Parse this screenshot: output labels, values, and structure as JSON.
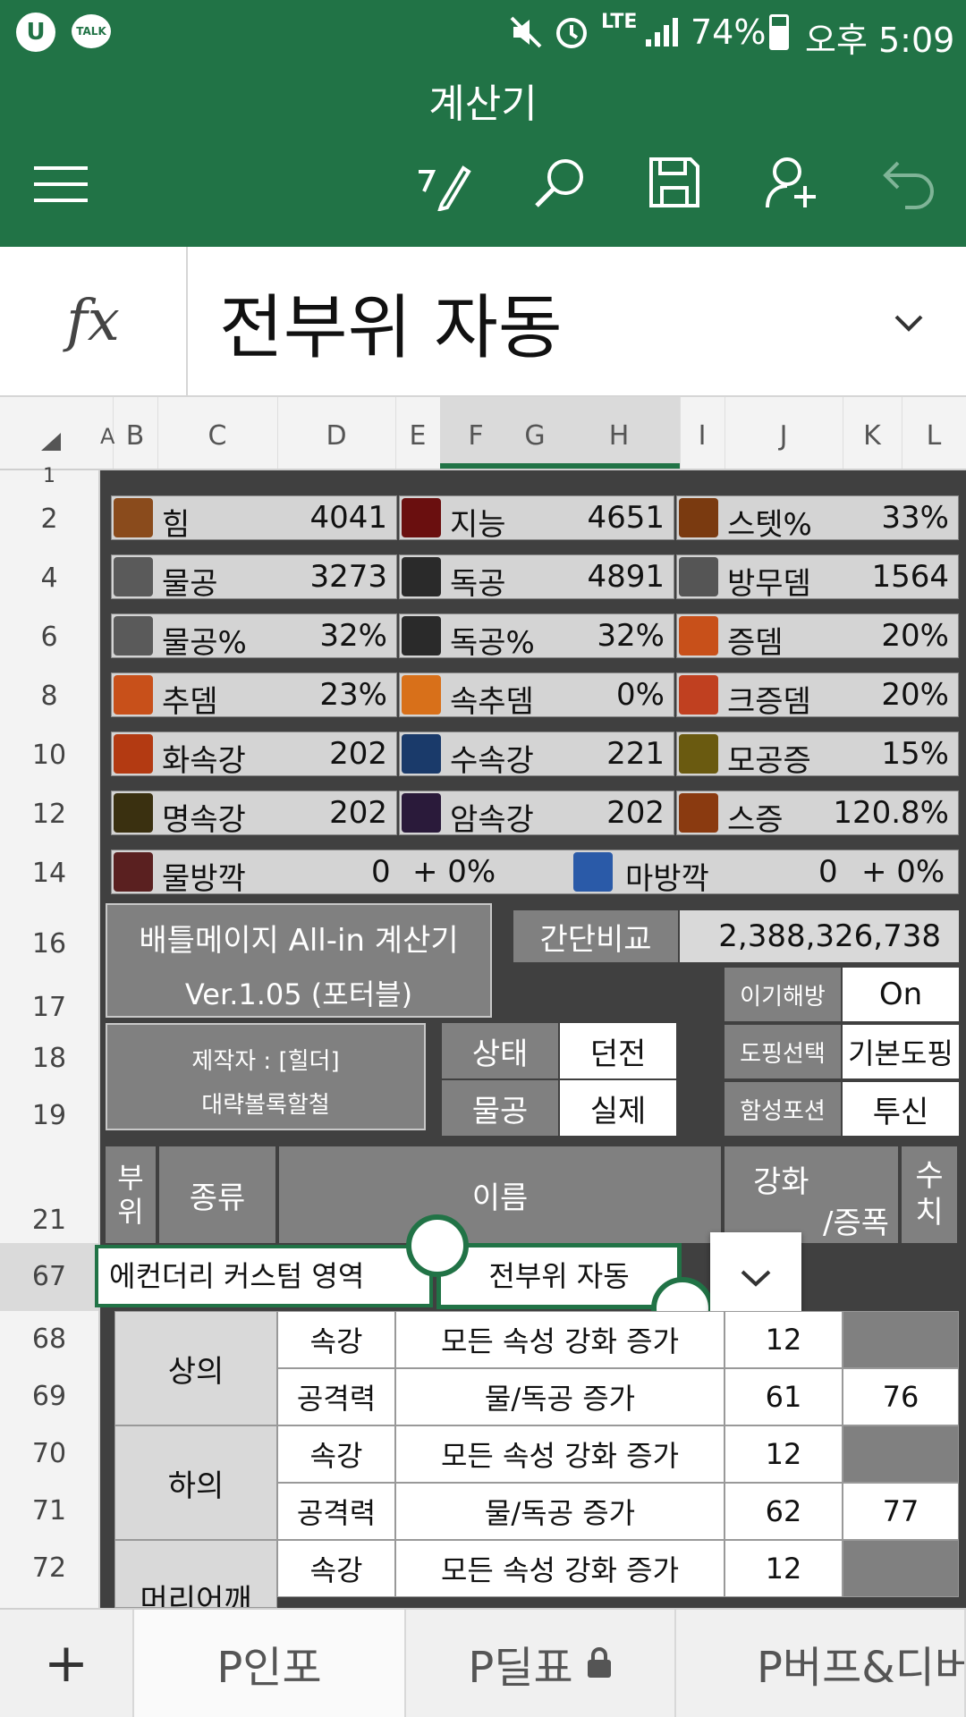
{
  "status_bar": {
    "battery": "74%",
    "time": "오후 5:09",
    "network": "LTE"
  },
  "app": {
    "title": "계산기"
  },
  "formula_bar": {
    "fx": "fx",
    "value": "전부위 자동"
  },
  "columns": [
    "A",
    "B",
    "C",
    "D",
    "E",
    "F",
    "G",
    "H",
    "I",
    "J",
    "K",
    "L"
  ],
  "rows": [
    "1",
    "2",
    "4",
    "6",
    "8",
    "10",
    "12",
    "14",
    "16",
    "17",
    "18",
    "19",
    "21",
    "67",
    "68",
    "69",
    "70",
    "71",
    "72"
  ],
  "stats": [
    {
      "label": "힘",
      "value": "4041"
    },
    {
      "label": "지능",
      "value": "4651"
    },
    {
      "label": "스텟%",
      "value": "33%"
    },
    {
      "label": "물공",
      "value": "3273"
    },
    {
      "label": "독공",
      "value": "4891"
    },
    {
      "label": "방무뎀",
      "value": "1564"
    },
    {
      "label": "물공%",
      "value": "32%"
    },
    {
      "label": "독공%",
      "value": "32%"
    },
    {
      "label": "증뎀",
      "value": "20%"
    },
    {
      "label": "추뎀",
      "value": "23%"
    },
    {
      "label": "속추뎀",
      "value": "0%"
    },
    {
      "label": "크증뎀",
      "value": "20%"
    },
    {
      "label": "화속강",
      "value": "202"
    },
    {
      "label": "수속강",
      "value": "221"
    },
    {
      "label": "모공증",
      "value": "15%"
    },
    {
      "label": "명속강",
      "value": "202"
    },
    {
      "label": "암속강",
      "value": "202"
    },
    {
      "label": "스증",
      "value": "120.8%"
    }
  ],
  "defense": {
    "phys": {
      "label": "물방깍",
      "value": "0",
      "extra": "+ 0%"
    },
    "magic": {
      "label": "마방깍",
      "value": "0",
      "extra": "+ 0%"
    }
  },
  "info": {
    "title1": "배틀메이지 All-in 계산기",
    "title2": "Ver.1.05 (포터블)",
    "author1": "제작자 : [힐더]",
    "author2": "대략볼록할철",
    "compare_label": "간단비교",
    "compare_value": "2,388,326,738",
    "opts": [
      {
        "label": "이기해방",
        "value": "On"
      },
      {
        "label": "도핑선택",
        "value": "기본도핑"
      },
      {
        "label": "함성포션",
        "value": "투신"
      }
    ],
    "state": [
      {
        "label": "상태",
        "value": "던전"
      },
      {
        "label": "물공",
        "value": "실제"
      }
    ]
  },
  "table": {
    "headers": {
      "part": "부위",
      "kind": "종류",
      "name": "이름",
      "enchant": "강화",
      "enchant2": "/증폭",
      "num": "수치"
    },
    "custom_label": "에컨더리 커스텀 영역",
    "dropdown_value": "전부위 자동",
    "rows": [
      {
        "part": "상의",
        "kind": "속강",
        "name": "모든 속성 강화 증가",
        "val1": "12",
        "val2": ""
      },
      {
        "part": "",
        "kind": "공격력",
        "name": "물/독공 증가",
        "val1": "61",
        "val2": "76"
      },
      {
        "part": "하의",
        "kind": "속강",
        "name": "모든 속성 강화 증가",
        "val1": "12",
        "val2": ""
      },
      {
        "part": "",
        "kind": "공격력",
        "name": "물/독공 증가",
        "val1": "62",
        "val2": "77"
      },
      {
        "part": "머리어깨",
        "kind": "속강",
        "name": "모든 속성 강화 증가",
        "val1": "12",
        "val2": ""
      }
    ]
  },
  "tabs": [
    {
      "label": "+"
    },
    {
      "label": "P인포"
    },
    {
      "label": "P딜표"
    },
    {
      "label": "P버프&디버"
    }
  ],
  "colors": {
    "excel_green": "#217346",
    "sheet_dark": "#404040",
    "cell_grey": "#808080",
    "stat_bg": "#d4d4d4"
  }
}
